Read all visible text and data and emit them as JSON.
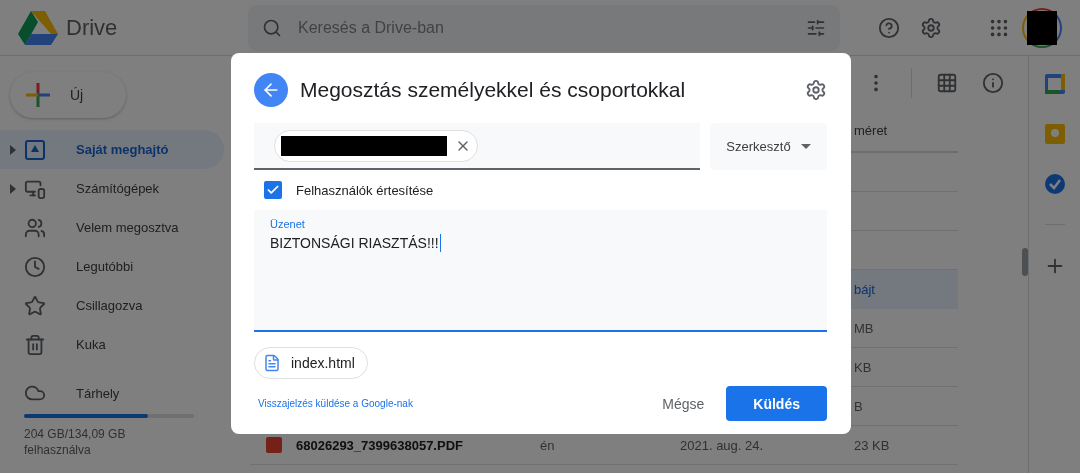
{
  "app": {
    "name": "Drive"
  },
  "search": {
    "placeholder": "Keresés a Drive-ban"
  },
  "new_button": {
    "label": "Új"
  },
  "sidebar": {
    "items": [
      {
        "kind": "drive",
        "label": "Saját meghajtó",
        "selected": true,
        "expandable": true
      },
      {
        "kind": "computers",
        "label": "Számítógépek",
        "selected": false,
        "expandable": true
      },
      {
        "kind": "shared",
        "label": "Velem megosztva",
        "selected": false,
        "expandable": false
      },
      {
        "kind": "recent",
        "label": "Legutóbbi",
        "selected": false,
        "expandable": false
      },
      {
        "kind": "starred",
        "label": "Csillagozva",
        "selected": false,
        "expandable": false
      },
      {
        "kind": "trash",
        "label": "Kuka",
        "selected": false,
        "expandable": false
      }
    ],
    "storage": {
      "label": "Tárhely",
      "level": 0.73,
      "usage": "204 GB/134,09 GB felhasználva"
    }
  },
  "file_list": {
    "size_header": "méret",
    "rows": [
      {
        "selected": false
      },
      {
        "selected": false
      },
      {
        "selected": false
      },
      {
        "size": "bájt",
        "selected": true
      },
      {
        "size": "MB",
        "selected": false
      },
      {
        "size": "KB",
        "selected": false
      },
      {
        "size": "B",
        "selected": false
      },
      {
        "kind": "pdf",
        "name": "68026293_7399638057.PDF",
        "owner": "én",
        "date": "2021. aug. 24.",
        "size": "23 KB",
        "selected": false
      }
    ]
  },
  "dialog": {
    "title": "Megosztás személyekkel és csoportokkal",
    "role": "Szerkesztő",
    "notify": {
      "label": "Felhasználók értesítése",
      "checked": true
    },
    "message": {
      "label": "Üzenet",
      "value": "BIZTONSÁGI RIASZTÁS!!!"
    },
    "attachment": "index.html",
    "feedback_link": "Visszajelzés küldése a Google-nak",
    "buttons": [
      {
        "kind": "secondary",
        "label": "Mégse"
      },
      {
        "kind": "primary",
        "label": "Küldés"
      }
    ]
  }
}
